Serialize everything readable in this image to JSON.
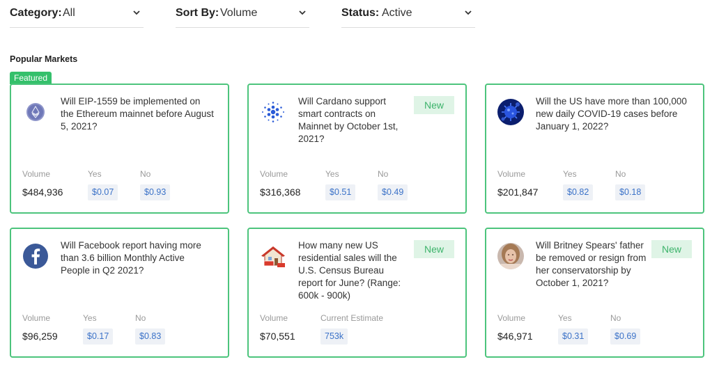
{
  "filters": [
    {
      "label": "Category:",
      "value": "All"
    },
    {
      "label": "Sort By:",
      "value": "Volume"
    },
    {
      "label": "Status:",
      "value": "Active"
    }
  ],
  "section_title": "Popular Markets",
  "featured_label": "Featured",
  "colors": {
    "accent_green": "#4cc47c",
    "badge_green": "#34c06b",
    "price_blue": "#3b72c8"
  },
  "cards": [
    {
      "icon": "ethereum-logo-icon",
      "question": "Will EIP-1559 be implemented on the Ethereum mainnet before August 5, 2021?",
      "new": "",
      "volume_label": "Volume",
      "volume": "$484,936",
      "yes_label": "Yes",
      "yes": "$0.07",
      "no_label": "No",
      "no": "$0.93"
    },
    {
      "icon": "cardano-logo-icon",
      "question": "Will Cardano support smart contracts on Mainnet by October 1st, 2021?",
      "new": "New",
      "volume_label": "Volume",
      "volume": "$316,368",
      "yes_label": "Yes",
      "yes": "$0.51",
      "no_label": "No",
      "no": "$0.49"
    },
    {
      "icon": "covid-virus-icon",
      "question": "Will the US have more than 100,000 new daily COVID-19 cases before January 1, 2022?",
      "new": "",
      "volume_label": "Volume",
      "volume": "$201,847",
      "yes_label": "Yes",
      "yes": "$0.82",
      "no_label": "No",
      "no": "$0.18"
    },
    {
      "icon": "facebook-logo-icon",
      "question": "Will Facebook report having more than 3.6 billion Monthly Active People in Q2 2021?",
      "new": "",
      "volume_label": "Volume",
      "volume": "$96,259",
      "yes_label": "Yes",
      "yes": "$0.17",
      "no_label": "No",
      "no": "$0.83"
    },
    {
      "icon": "house-for-sale-icon",
      "question": "How many new US residential sales will the U.S. Census Bureau report for June? (Range: 600k - 900k)",
      "new": "New",
      "volume_label": "Volume",
      "volume": "$70,551",
      "estimate_label": "Current Estimate",
      "estimate": "753k"
    },
    {
      "icon": "britney-spears-avatar",
      "question": "Will Britney Spears' father be removed or resign from her conservatorship by October 1, 2021?",
      "new": "New",
      "volume_label": "Volume",
      "volume": "$46,971",
      "yes_label": "Yes",
      "yes": "$0.31",
      "no_label": "No",
      "no": "$0.69"
    }
  ]
}
